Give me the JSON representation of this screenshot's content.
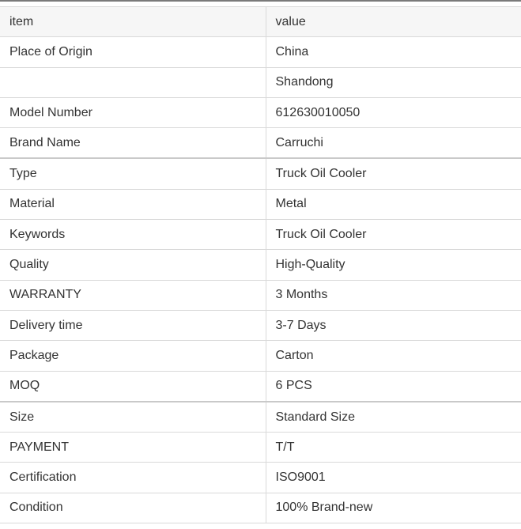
{
  "table": {
    "header": {
      "item": "item",
      "value": "value"
    },
    "rows": [
      {
        "item": "Place of Origin",
        "value": "China"
      },
      {
        "item": "",
        "value": "Shandong"
      },
      {
        "item": "Model Number",
        "value": "612630010050"
      },
      {
        "item": "Brand Name",
        "value": "Carruchi"
      },
      {
        "item": "Type",
        "value": "Truck Oil Cooler"
      },
      {
        "item": "Material",
        "value": "Metal"
      },
      {
        "item": "Keywords",
        "value": "Truck Oil Cooler"
      },
      {
        "item": "Quality",
        "value": "High-Quality"
      },
      {
        "item": "WARRANTY",
        "value": "3 Months"
      },
      {
        "item": "Delivery time",
        "value": "3-7 Days"
      },
      {
        "item": "Package",
        "value": "Carton"
      },
      {
        "item": "MOQ",
        "value": "6 PCS"
      },
      {
        "item": "Size",
        "value": "Standard Size"
      },
      {
        "item": "PAYMENT",
        "value": "T/T"
      },
      {
        "item": "Certification",
        "value": "ISO9001"
      },
      {
        "item": "Condition",
        "value": "100% Brand-new"
      }
    ]
  }
}
